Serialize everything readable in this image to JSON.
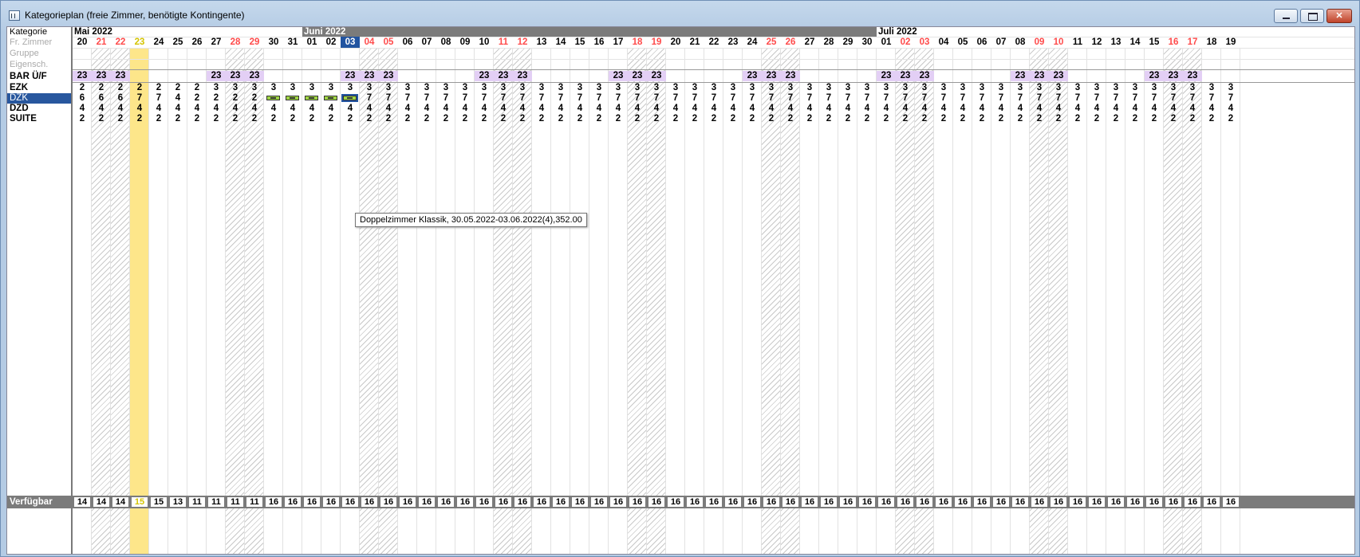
{
  "window": {
    "title": "Kategorieplan (freie Zimmer, benötigte Kontingente)"
  },
  "colors": {
    "weekend": "#ff4a4a",
    "today": "#fde68a",
    "selected": "#2254a0",
    "bar": "#e3cff5",
    "occupancy": "#9ed443"
  },
  "left": {
    "header_label": "Kategorie",
    "dim_labels": [
      "Fr. Zimmer",
      "Gruppe",
      "Eigensch."
    ],
    "rate_label": "BAR Ü/F",
    "footer_label": "Verfügbar"
  },
  "months": [
    {
      "label": "Mai 2022",
      "start_index": 0,
      "span": 12,
      "dark": false
    },
    {
      "label": "Juni 2022",
      "start_index": 12,
      "span": 30,
      "dark": true
    },
    {
      "label": "Juli 2022",
      "start_index": 42,
      "span": 19,
      "dark": false
    }
  ],
  "days": [
    "20",
    "21",
    "22",
    "23",
    "24",
    "25",
    "26",
    "27",
    "28",
    "29",
    "30",
    "31",
    "01",
    "02",
    "03",
    "04",
    "05",
    "06",
    "07",
    "08",
    "09",
    "10",
    "11",
    "12",
    "13",
    "14",
    "15",
    "16",
    "17",
    "18",
    "19",
    "20",
    "21",
    "22",
    "23",
    "24",
    "25",
    "26",
    "27",
    "28",
    "29",
    "30",
    "01",
    "02",
    "03",
    "04",
    "05",
    "06",
    "07",
    "08",
    "09",
    "10",
    "11",
    "12",
    "13",
    "14",
    "15",
    "16",
    "17",
    "18",
    "19"
  ],
  "weekend_indices": [
    1,
    2,
    8,
    9,
    15,
    16,
    22,
    23,
    29,
    30,
    36,
    37,
    43,
    44,
    50,
    51,
    57,
    58
  ],
  "hatched_indices": [
    1,
    2,
    8,
    9,
    15,
    16,
    22,
    23,
    29,
    30,
    36,
    37,
    43,
    44,
    50,
    51,
    57,
    58
  ],
  "today_index": 3,
  "selected_index": 14,
  "rate_indices": [
    0,
    1,
    2,
    7,
    8,
    9,
    14,
    15,
    16,
    21,
    22,
    23,
    28,
    29,
    30,
    35,
    36,
    37,
    42,
    43,
    44,
    49,
    50,
    51,
    56,
    57,
    58
  ],
  "rate_value": "23",
  "categories": [
    {
      "code": "EZK",
      "selected": false,
      "values": [
        "2",
        "2",
        "2",
        "2",
        "2",
        "2",
        "2",
        "3",
        "3",
        "3",
        "3",
        "3",
        "3",
        "3",
        "3",
        "3",
        "3",
        "3",
        "3",
        "3",
        "3",
        "3",
        "3",
        "3",
        "3",
        "3",
        "3",
        "3",
        "3",
        "3",
        "3",
        "3",
        "3",
        "3",
        "3",
        "3",
        "3",
        "3",
        "3",
        "3",
        "3",
        "3",
        "3",
        "3",
        "3",
        "3",
        "3",
        "3",
        "3",
        "3",
        "3",
        "3",
        "3",
        "3",
        "3",
        "3",
        "3",
        "3",
        "3",
        "3",
        "3"
      ]
    },
    {
      "code": "DZK",
      "selected": true,
      "values": [
        "6",
        "6",
        "6",
        "7",
        "7",
        "4",
        "2",
        "2",
        "2",
        "2",
        "",
        "",
        "",
        "",
        "",
        "7",
        "7",
        "7",
        "7",
        "7",
        "7",
        "7",
        "7",
        "7",
        "7",
        "7",
        "7",
        "7",
        "7",
        "7",
        "7",
        "7",
        "7",
        "7",
        "7",
        "7",
        "7",
        "7",
        "7",
        "7",
        "7",
        "7",
        "7",
        "7",
        "7",
        "7",
        "7",
        "7",
        "7",
        "7",
        "7",
        "7",
        "7",
        "7",
        "7",
        "7",
        "7",
        "7",
        "7",
        "7",
        "7"
      ],
      "occupancy_indices": [
        10,
        11,
        12,
        13,
        14
      ],
      "occupancy_selected_index": 14
    },
    {
      "code": "DZD",
      "selected": false,
      "values": [
        "4",
        "4",
        "4",
        "4",
        "4",
        "4",
        "4",
        "4",
        "4",
        "4",
        "4",
        "4",
        "4",
        "4",
        "4",
        "4",
        "4",
        "4",
        "4",
        "4",
        "4",
        "4",
        "4",
        "4",
        "4",
        "4",
        "4",
        "4",
        "4",
        "4",
        "4",
        "4",
        "4",
        "4",
        "4",
        "4",
        "4",
        "4",
        "4",
        "4",
        "4",
        "4",
        "4",
        "4",
        "4",
        "4",
        "4",
        "4",
        "4",
        "4",
        "4",
        "4",
        "4",
        "4",
        "4",
        "4",
        "4",
        "4",
        "4",
        "4",
        "4"
      ]
    },
    {
      "code": "SUITE",
      "selected": false,
      "values": [
        "2",
        "2",
        "2",
        "2",
        "2",
        "2",
        "2",
        "2",
        "2",
        "2",
        "2",
        "2",
        "2",
        "2",
        "2",
        "2",
        "2",
        "2",
        "2",
        "2",
        "2",
        "2",
        "2",
        "2",
        "2",
        "2",
        "2",
        "2",
        "2",
        "2",
        "2",
        "2",
        "2",
        "2",
        "2",
        "2",
        "2",
        "2",
        "2",
        "2",
        "2",
        "2",
        "2",
        "2",
        "2",
        "2",
        "2",
        "2",
        "2",
        "2",
        "2",
        "2",
        "2",
        "2",
        "2",
        "2",
        "2",
        "2",
        "2",
        "2",
        "2"
      ]
    }
  ],
  "available": [
    "14",
    "14",
    "14",
    "15",
    "15",
    "13",
    "11",
    "11",
    "11",
    "11",
    "16",
    "16",
    "16",
    "16",
    "16",
    "16",
    "16",
    "16",
    "16",
    "16",
    "16",
    "16",
    "16",
    "16",
    "16",
    "16",
    "16",
    "16",
    "16",
    "16",
    "16",
    "16",
    "16",
    "16",
    "16",
    "16",
    "16",
    "16",
    "16",
    "16",
    "16",
    "16",
    "16",
    "16",
    "16",
    "16",
    "16",
    "16",
    "16",
    "16",
    "16",
    "16",
    "16",
    "16",
    "16",
    "16",
    "16",
    "16",
    "16",
    "16",
    "16"
  ],
  "tooltip": "Doppelzimmer Klassik, 30.05.2022-03.06.2022(4),352.00"
}
